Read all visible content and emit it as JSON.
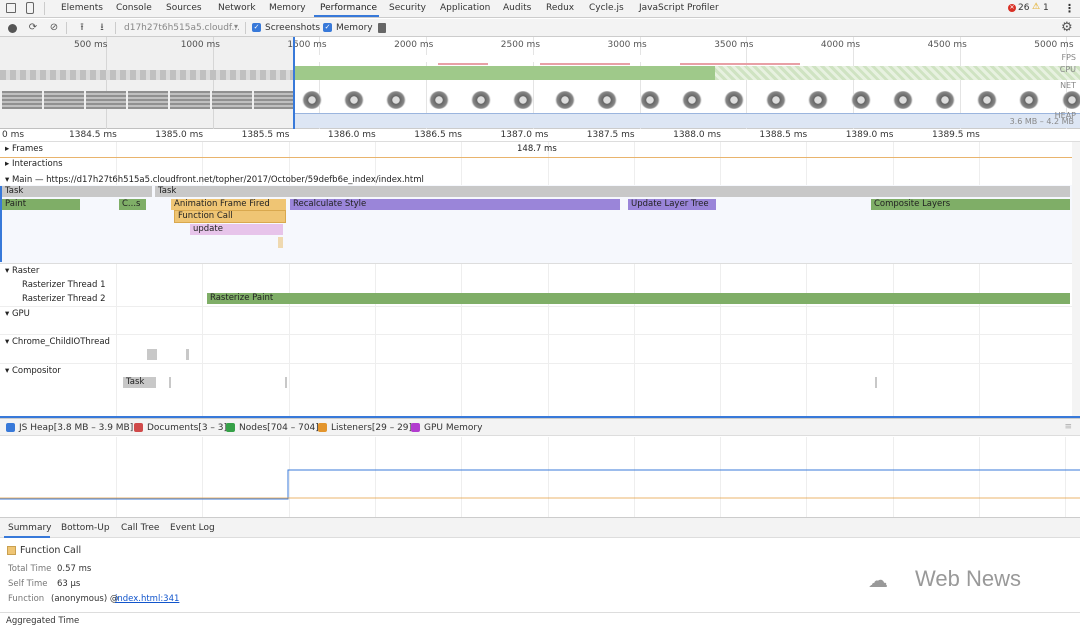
{
  "tabs": [
    "Elements",
    "Console",
    "Sources",
    "Network",
    "Memory",
    "Performance",
    "Security",
    "Application",
    "Audits",
    "Redux",
    "Cycle.js",
    "JavaScript Profiler"
  ],
  "status": {
    "errors": "26",
    "warnings": "1"
  },
  "toolbar": {
    "url": "d17h27t6h515a5.cloudf...",
    "screenshots_label": "Screenshots",
    "memory_label": "Memory"
  },
  "overview": {
    "ticks": [
      "500 ms",
      "1000 ms",
      "1500 ms",
      "2000 ms",
      "2500 ms",
      "3000 ms",
      "3500 ms",
      "4000 ms",
      "4500 ms",
      "5000 ms"
    ],
    "lanes": {
      "fps": "FPS",
      "cpu": "CPU",
      "net": "NET",
      "heap": "HEAP",
      "heap_range": "3.6 MB – 4.2 MB"
    }
  },
  "timeruler": [
    "0 ms",
    "1384.5 ms",
    "1385.0 ms",
    "1385.5 ms",
    "1386.0 ms",
    "1386.5 ms",
    "1387.0 ms",
    "1387.5 ms",
    "1388.0 ms",
    "1388.5 ms",
    "1389.0 ms",
    "1389.5 ms"
  ],
  "tracks": {
    "frames": "Frames",
    "frame_duration": "148.7 ms",
    "interactions": "Interactions",
    "main": "Main — https://d17h27t6h515a5.cloudfront.net/topher/2017/October/59defb6e_index/index.html",
    "raster": "Raster",
    "raster1": "Rasterizer Thread 1",
    "raster2": "Rasterizer Thread 2",
    "gpu": "GPU",
    "childio": "Chrome_ChildIOThread",
    "compositor": "Compositor"
  },
  "events": {
    "task1": "Task",
    "task2": "Task",
    "paint": "Paint",
    "cs": "C...s",
    "anim": "Animation Frame Fired",
    "recalc": "Recalculate Style",
    "layer": "Update Layer Tree",
    "composite": "Composite Layers",
    "func": "Function Call",
    "update": "update",
    "rasterize": "Rasterize Paint",
    "ctask": "Task"
  },
  "counters": {
    "jsheap": "JS Heap[3.8 MB – 3.9 MB]",
    "documents": "Documents[3 – 3]",
    "nodes": "Nodes[704 – 704]",
    "listeners": "Listeners[29 – 29]",
    "gpu": "GPU Memory",
    "colors": {
      "jsheap": "#3879d9",
      "documents": "#d04a4a",
      "nodes": "#36a148",
      "listeners": "#e3952d",
      "gpu": "#b23ccf"
    }
  },
  "bottom_tabs": [
    "Summary",
    "Bottom-Up",
    "Call Tree",
    "Event Log"
  ],
  "summary": {
    "title": "Function Call",
    "total_label": "Total Time",
    "total_value": "0.57 ms",
    "self_label": "Self Time",
    "self_value": "63 µs",
    "func_label": "Function",
    "func_value": "(anonymous) @",
    "func_link": "index.html:341",
    "aggregated": "Aggregated Time"
  },
  "watermark": "Web News",
  "colors": {
    "paint": "#7fae67",
    "recalc": "#9a85d9",
    "scripting": "#efc574",
    "update": "#e7c4ea",
    "task": "#c8c8c8",
    "accent": "#3879d9"
  }
}
